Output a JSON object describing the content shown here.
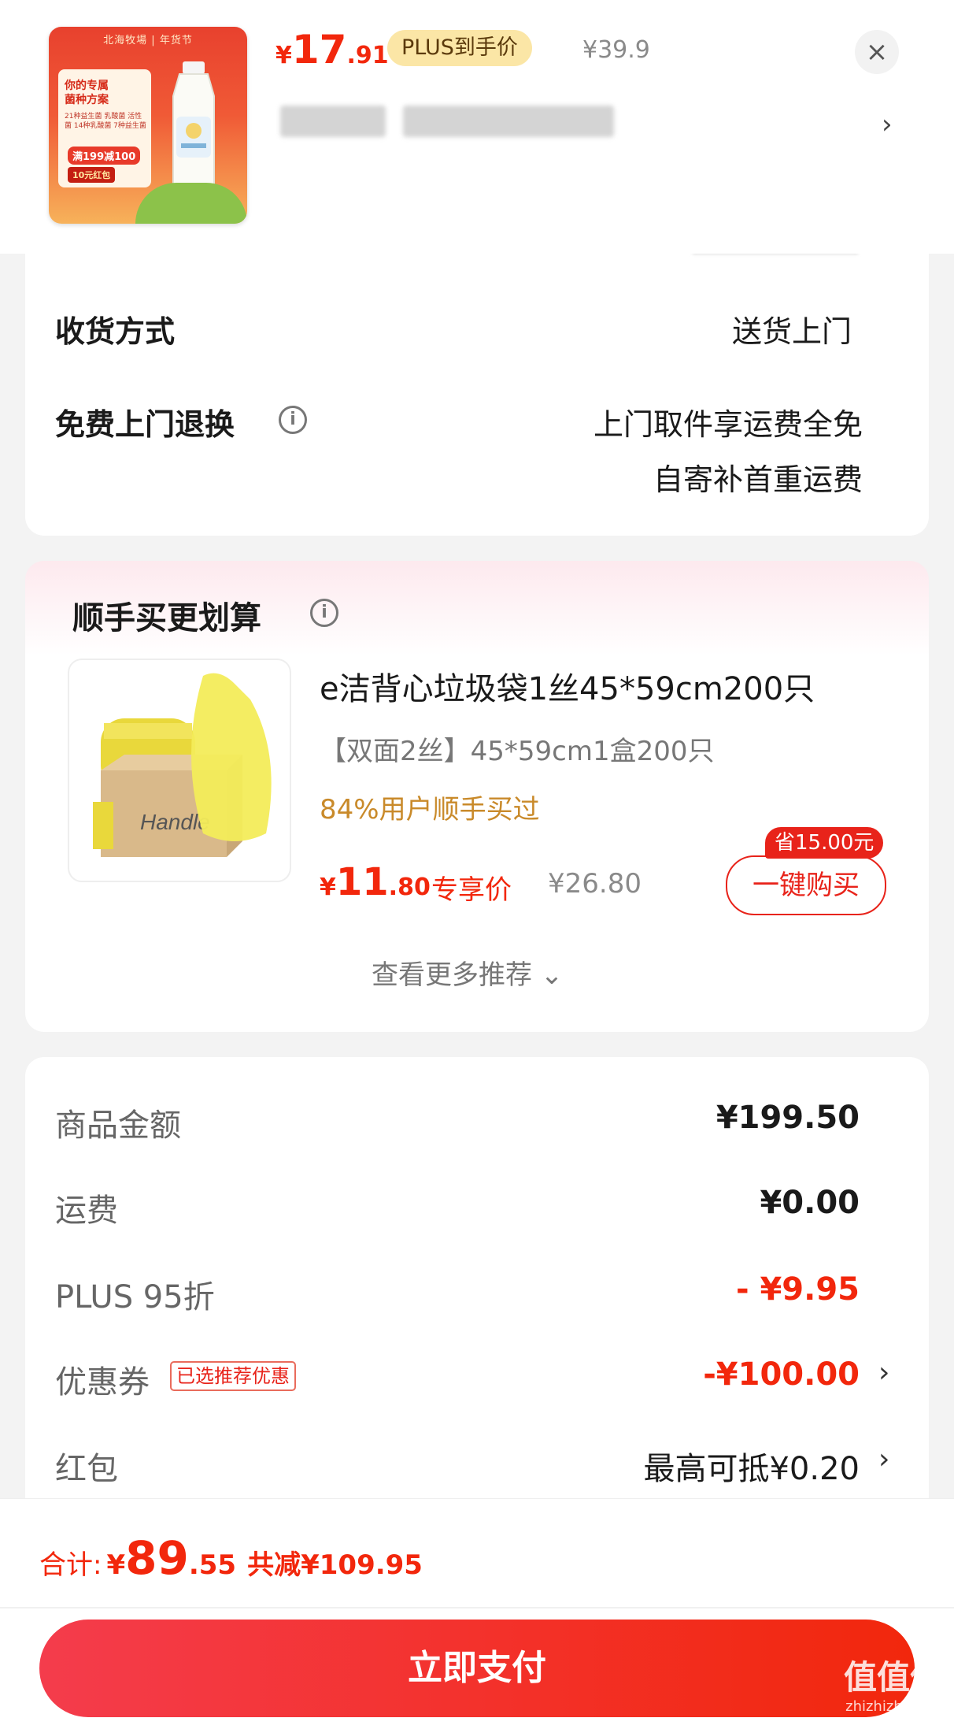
{
  "header": {
    "thumbnail": {
      "brand": "北海牧場 | 年货节",
      "headline": "你的专属\n菌种方案",
      "detail": "21种益生菌 乳酸菌 活性菌 14种乳酸菌 7种益生菌",
      "price_badge": "满199减100",
      "red_packet": "10元红包"
    },
    "price_currency": "¥",
    "price_int": "17",
    "price_dec": ".91",
    "plus_badge": "PLUS到手价",
    "original_price": "¥39.9",
    "close_icon": "×",
    "spec_chevron": "›"
  },
  "delivery": {
    "rows": [
      {
        "label": "收货方式",
        "value": "送货上门"
      },
      {
        "label": "免费上门退换",
        "value_line1": "上门取件享运费全免",
        "value_line2": "自寄补首重运费"
      }
    ],
    "info_glyph": "i"
  },
  "recommend": {
    "title": "顺手买更划算",
    "product_name": "e洁背心垃圾袋1丝45*59cm200只",
    "spec": "【双面2丝】45*59cm1盒200只",
    "social_proof": "84%用户顺手买过",
    "price_currency": "¥",
    "price_int": "11",
    "price_dec": ".80",
    "exclusive_label": "专享价",
    "original_price": "¥26.80",
    "save_badge": "省15.00元",
    "buy_button": "一键购买",
    "more_link": "查看更多推荐 ⌄",
    "thumb_box_text": "Handle"
  },
  "summary": {
    "rows": [
      {
        "label": "商品金额",
        "value": "¥199.50"
      },
      {
        "label": "运费",
        "value": "¥0.00"
      },
      {
        "label": "PLUS 95折",
        "value": "- ¥9.95"
      },
      {
        "label": "优惠券",
        "tag": "已选推荐优惠",
        "value": "-¥100.00"
      },
      {
        "label": "红包",
        "value": "最高可抵¥0.20"
      }
    ],
    "chevron": "›"
  },
  "footer": {
    "total_label": "合计:",
    "total_currency": "¥",
    "total_int": "89",
    "total_dec": ".55",
    "total_saved": "共减¥109.95",
    "pay_button": "立即支付",
    "watermark": "值值值",
    "watermark_url": "zhizhizhi.com"
  },
  "colors": {
    "accent": "#f2270c",
    "plus_badge_bg": "#fbe6a6",
    "social_proof": "#c98a2a"
  }
}
